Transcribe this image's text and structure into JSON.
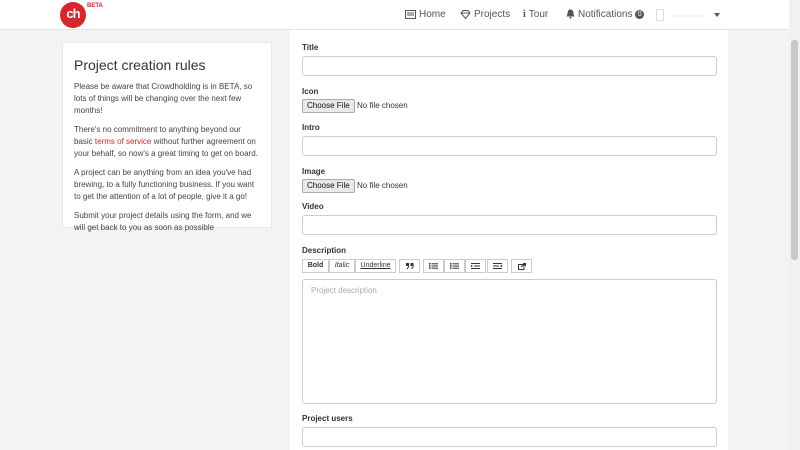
{
  "header": {
    "logo_text": "ch",
    "beta_label": "BETA",
    "nav": {
      "home": "Home",
      "projects": "Projects",
      "tour": "Tour",
      "notifications": "Notifications",
      "notification_count": "0"
    }
  },
  "sidebar": {
    "title": "Project creation rules",
    "p1": "Please be aware that Crowdholding is in BETA, so lots of things will be changing over the next few months!",
    "p2_before": "There's no commitment to anything beyond our basic ",
    "p2_link": "terms of service",
    "p2_after": " without further agreement on your behalf, so now's a great timing to get on board.",
    "p3": "A project can be anything from an idea you've had brewing, to a fully functioning business. If you want to get the attention of a lot of people, give it a go!",
    "p4": "Submit your project details using the form, and we will get back to you as soon as possible"
  },
  "form": {
    "title_label": "Title",
    "icon_label": "Icon",
    "intro_label": "Intro",
    "image_label": "Image",
    "video_label": "Video",
    "description_label": "Description",
    "users_label": "Project users",
    "choose_file": "Choose File",
    "no_file": "No file chosen",
    "description_placeholder": "Project description",
    "toolbar": {
      "bold": "Bold",
      "italic": "Italic",
      "underline": "Underline"
    }
  },
  "colors": {
    "brand": "#d9262d"
  }
}
